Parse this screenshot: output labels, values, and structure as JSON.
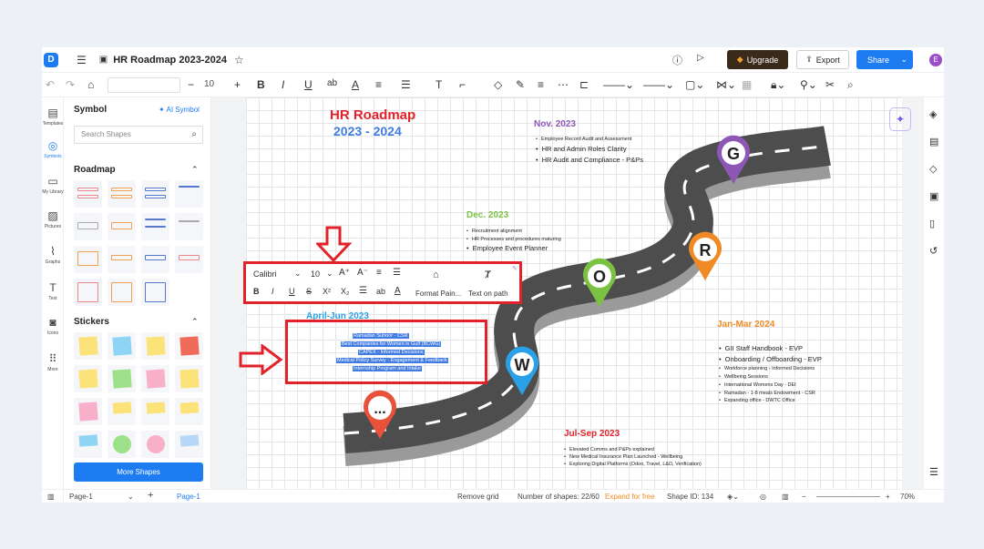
{
  "app": {
    "logo": "D",
    "doc_title": "HR Roadmap 2023-2024"
  },
  "topbar": {
    "upgrade": "Upgrade",
    "export": "Export",
    "share": "Share",
    "avatar": "E"
  },
  "toolbar": {
    "font_size": "10"
  },
  "left_rail": [
    "Templates",
    "Symbols",
    "My Library",
    "Pictures",
    "Graphs",
    "Text",
    "Icons",
    "More"
  ],
  "panel": {
    "title": "Symbol",
    "ai_symbol": "AI Symbol",
    "search_placeholder": "Search Shapes",
    "roadmap": "Roadmap",
    "stickers": "Stickers",
    "more_shapes": "More Shapes"
  },
  "diagram": {
    "title_line1": "HR Roadmap",
    "title_line2": "2023 - 2024",
    "nov_title": "Nov. 2023",
    "nov_items": [
      "Employee Record Audit and Assessment",
      "HR and Admin Roles Clarity",
      "HR Audit and Compliance - P&Ps"
    ],
    "dec_title": "Dec. 2023",
    "dec_items": [
      "Recruitment alignment",
      "HR Processes and procedures maturing",
      "Employee Event Planner"
    ],
    "apr_title": "April-Jun 2023",
    "apr_items": [
      "Ramadan Suhoor - CSR",
      "Best Companies for Women in Gulf (BCWG)",
      "CAPEX - Informed Decisions",
      "Medical Policy Survey - Engagement & Feedback",
      "Internship Program and Intake"
    ],
    "jan_title": "Jan-Mar 2024",
    "jan_items": [
      "GII Staff Handbook - EVP",
      "Onboarding / Offboarding - EVP",
      "Workforce planning - Informed Decisions",
      "Wellbeing Sessions",
      "International Womens Day - DEI",
      "Ramadan - 1-8 meals Endowment - CSR",
      "Expanding office - DWTC Office"
    ],
    "jul_title": "Jul-Sep 2023",
    "jul_items": [
      "Elevated Comms and P&Ps explained",
      "New Medical Insurance Plan Launched - Wellbeing",
      "Exploring Digital Platforms (Odoo, Travel, L&D, Verification)"
    ],
    "pins": [
      "G",
      "R",
      "O",
      "W",
      "..."
    ]
  },
  "format_bar": {
    "font": "Calibri",
    "size": "10",
    "format_painter": "Format Pain...",
    "text_on_path": "Text on path"
  },
  "statusbar": {
    "page_select": "Page-1",
    "page_tab": "Page-1",
    "remove_grid": "Remove grid",
    "shapes": "Number of shapes: 22/60",
    "expand": "Expand for free",
    "shape_id": "Shape ID: 134",
    "zoom": "70%"
  },
  "colors": {
    "accent": "#1e7cf2",
    "red": "#e2222a",
    "purple": "#8e57b6",
    "orange": "#f08a24",
    "green": "#7cc242",
    "blue": "#2aa0e8",
    "road": "#4a4a4a"
  }
}
